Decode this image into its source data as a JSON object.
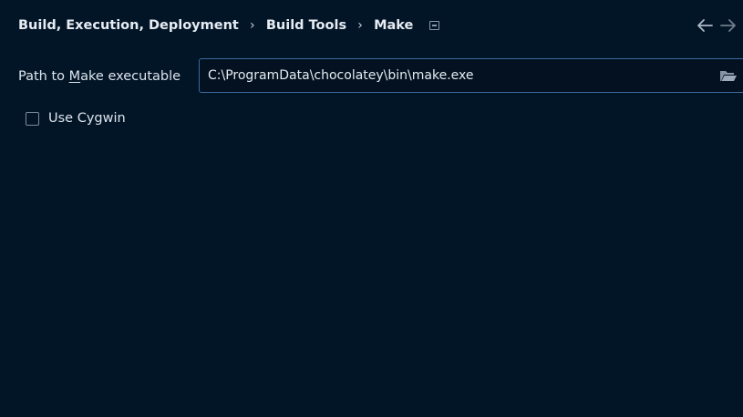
{
  "breadcrumb": {
    "items": [
      "Build, Execution, Deployment",
      "Build Tools",
      "Make"
    ],
    "separator": "›"
  },
  "icons": {
    "pin": "pin-icon",
    "back": "arrow-left-icon",
    "forward": "arrow-right-icon",
    "browse": "folder-open-icon"
  },
  "make_settings": {
    "path_label_prefix": "Path to ",
    "path_label_mnemonic": "M",
    "path_label_suffix": "ake executable",
    "path_value": "C:\\ProgramData\\chocolatey\\bin\\make.exe",
    "use_cygwin_label": "Use Cygwin",
    "use_cygwin_checked": false
  },
  "colors": {
    "background": "#021527",
    "input_border": "#3a6a9c",
    "text": "#dfe6ee"
  }
}
